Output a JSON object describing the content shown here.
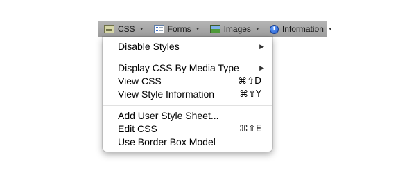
{
  "toolbar": {
    "items": [
      {
        "label": "CSS",
        "icon": "css-icon"
      },
      {
        "label": "Forms",
        "icon": "forms-icon"
      },
      {
        "label": "Images",
        "icon": "image-icon"
      },
      {
        "label": "Information",
        "icon": "info-icon",
        "glyph": "i"
      }
    ],
    "dropdown_glyph": "▼"
  },
  "menu": {
    "items": [
      {
        "label": "Disable Styles",
        "submenu_glyph": "▶"
      },
      {
        "label": "Display CSS By Media Type",
        "submenu_glyph": "▶"
      },
      {
        "label": "View CSS",
        "shortcut": "⌘⇧D"
      },
      {
        "label": "View Style Information",
        "shortcut": "⌘⇧Y"
      },
      {
        "label": "Add User Style Sheet..."
      },
      {
        "label": "Edit CSS",
        "shortcut": "⌘⇧E"
      },
      {
        "label": "Use Border Box Model"
      }
    ]
  }
}
